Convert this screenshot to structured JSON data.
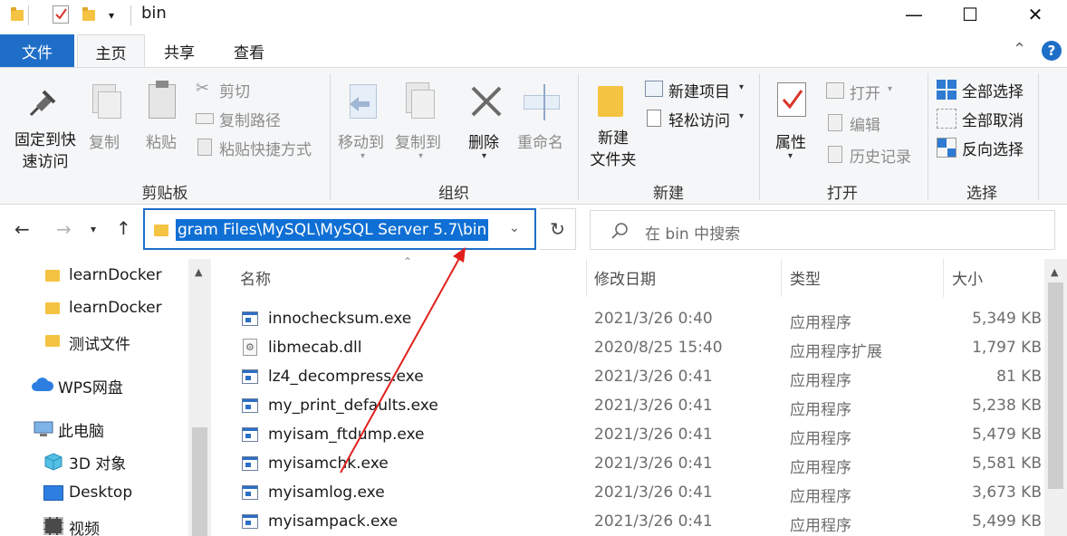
{
  "window": {
    "title": "bin",
    "buttons": {
      "minimize": "—",
      "maximize": "☐",
      "close": "✕"
    }
  },
  "tabs": [
    "文件",
    "主页",
    "共享",
    "查看"
  ],
  "ribbon": {
    "clipboard": {
      "pin": "固定到快\n速访问",
      "copy": "复制",
      "paste": "粘贴",
      "cut": "剪切",
      "copy_path": "复制路径",
      "paste_shortcut": "粘贴快捷方式",
      "group_label": "剪贴板"
    },
    "organize": {
      "move_to": "移动到",
      "copy_to": "复制到",
      "delete": "删除",
      "rename": "重命名",
      "group_label": "组织"
    },
    "new": {
      "new_folder": "新建\n文件夹",
      "new_item": "新建项目",
      "easy_access": "轻松访问",
      "group_label": "新建"
    },
    "open": {
      "properties": "属性",
      "open": "打开",
      "edit": "编辑",
      "history": "历史记录",
      "group_label": "打开"
    },
    "select": {
      "select_all": "全部选择",
      "select_none": "全部取消",
      "invert": "反向选择",
      "group_label": "选择"
    }
  },
  "address": {
    "path": "gram Files\\MySQL\\MySQL Server 5.7\\bin",
    "search_placeholder": "在 bin 中搜索"
  },
  "nav": {
    "items": [
      {
        "label": "learnDocker",
        "icon": "folder-icon"
      },
      {
        "label": "learnDocker",
        "icon": "folder-icon"
      },
      {
        "label": "测试文件",
        "icon": "folder-icon"
      },
      {
        "label": "WPS网盘",
        "icon": "cloud-icon"
      },
      {
        "label": "此电脑",
        "icon": "computer-icon"
      },
      {
        "label": "3D 对象",
        "icon": "cube-icon"
      },
      {
        "label": "Desktop",
        "icon": "desktop-icon"
      },
      {
        "label": "视频",
        "icon": "video-icon"
      }
    ]
  },
  "columns": [
    "名称",
    "修改日期",
    "类型",
    "大小"
  ],
  "files": [
    {
      "name": "innochecksum.exe",
      "date": "2021/3/26 0:40",
      "type": "应用程序",
      "size": "5,349 KB",
      "icon": "exe-icon"
    },
    {
      "name": "libmecab.dll",
      "date": "2020/8/25 15:40",
      "type": "应用程序扩展",
      "size": "1,797 KB",
      "icon": "dll-icon"
    },
    {
      "name": "lz4_decompress.exe",
      "date": "2021/3/26 0:41",
      "type": "应用程序",
      "size": "81 KB",
      "icon": "exe-icon"
    },
    {
      "name": "my_print_defaults.exe",
      "date": "2021/3/26 0:41",
      "type": "应用程序",
      "size": "5,238 KB",
      "icon": "exe-icon"
    },
    {
      "name": "myisam_ftdump.exe",
      "date": "2021/3/26 0:41",
      "type": "应用程序",
      "size": "5,479 KB",
      "icon": "exe-icon"
    },
    {
      "name": "myisamchk.exe",
      "date": "2021/3/26 0:41",
      "type": "应用程序",
      "size": "5,581 KB",
      "icon": "exe-icon"
    },
    {
      "name": "myisamlog.exe",
      "date": "2021/3/26 0:41",
      "type": "应用程序",
      "size": "3,673 KB",
      "icon": "exe-icon"
    },
    {
      "name": "myisampack.exe",
      "date": "2021/3/26 0:41",
      "type": "应用程序",
      "size": "5,499 KB",
      "icon": "exe-icon"
    }
  ],
  "colors": {
    "accent": "#1e6ec8",
    "selection": "#0f6fd4",
    "annotation_arrow": "#e0201b"
  }
}
